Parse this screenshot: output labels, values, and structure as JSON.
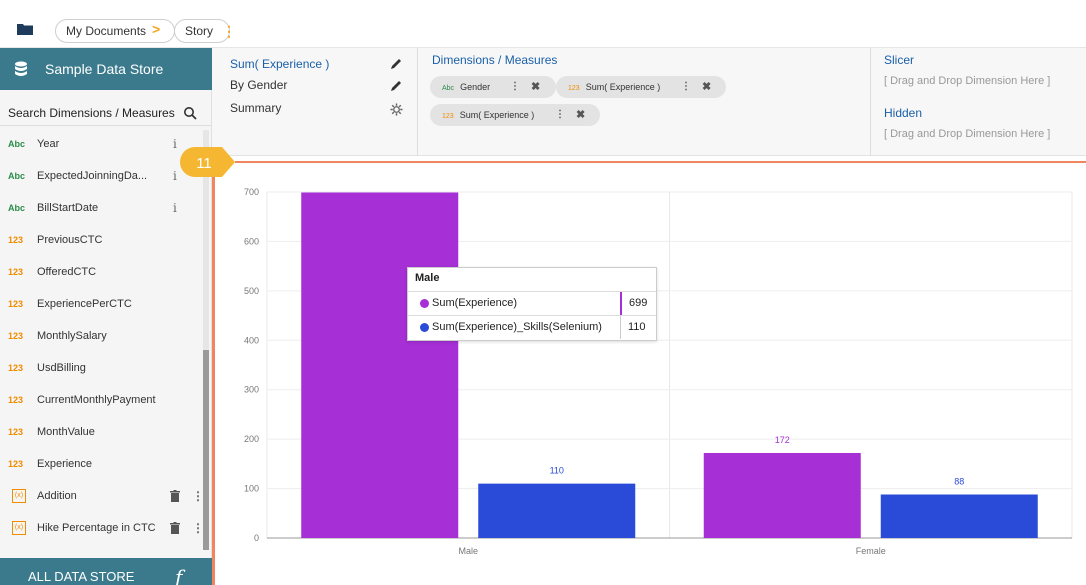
{
  "breadcrumb": {
    "items": [
      "My Documents",
      "Story"
    ]
  },
  "sidebar": {
    "store_title": "Sample Data Store",
    "search_label": "Search Dimensions / Measures",
    "fields": [
      {
        "type": "Abc",
        "name": "Year",
        "action": "info"
      },
      {
        "type": "Abc",
        "name": "ExpectedJoinningDa...",
        "action": "info"
      },
      {
        "type": "Abc",
        "name": "BillStartDate",
        "action": "info"
      },
      {
        "type": "123",
        "name": "PreviousCTC"
      },
      {
        "type": "123",
        "name": "OfferedCTC"
      },
      {
        "type": "123",
        "name": "ExperiencePerCTC"
      },
      {
        "type": "123",
        "name": "MonthlySalary"
      },
      {
        "type": "123",
        "name": "UsdBilling"
      },
      {
        "type": "123",
        "name": "CurrentMonthlyPayment"
      },
      {
        "type": "123",
        "name": "MonthValue"
      },
      {
        "type": "123",
        "name": "Experience"
      },
      {
        "type": "(x)",
        "name": "Addition",
        "action": "trash"
      },
      {
        "type": "(x)",
        "name": "Hike Percentage in CTC",
        "action": "trash"
      }
    ],
    "all_store_label": "ALL DATA STORE",
    "fx_glyph": "f"
  },
  "properties": {
    "items": [
      "Sum( Experience )",
      "By Gender",
      "Summary"
    ]
  },
  "dimensions_measures": {
    "title": "Dimensions / Measures",
    "pills": [
      {
        "type": "Abc",
        "label": "Gender"
      },
      {
        "type": "123",
        "label": "Sum( Experience )"
      },
      {
        "type": "123",
        "label": "Sum( Experience )"
      }
    ]
  },
  "slicer": {
    "title": "Slicer",
    "placeholder": "[ Drag and Drop Dimension Here ]"
  },
  "hidden": {
    "title": "Hidden",
    "placeholder": "[ Drag and Drop Dimension Here ]"
  },
  "step_badge": "11",
  "tooltip": {
    "title": "Male",
    "rows": [
      {
        "label": "Sum(Experience)",
        "value": "699",
        "color": "#a62fd6"
      },
      {
        "label": "Sum(Experience)_Skills(Selenium)",
        "value": "110",
        "color": "#2a4bd7"
      }
    ]
  },
  "colors": {
    "accent": "#f08660",
    "series1": "#a62fd6",
    "series2": "#2a4bd7",
    "header": "#3a7a8c"
  },
  "chart_data": {
    "type": "bar",
    "categories": [
      "Male",
      "Female"
    ],
    "series": [
      {
        "name": "Sum(Experience)",
        "values": [
          699,
          172
        ],
        "color": "#a62fd6",
        "labels": [
          "",
          "172"
        ]
      },
      {
        "name": "Sum(Experience)_Skills(Selenium)",
        "values": [
          110,
          88
        ],
        "color": "#2a4bd7",
        "labels": [
          "110",
          "88"
        ]
      }
    ],
    "ylim": [
      0,
      700
    ],
    "yticks": [
      0,
      100,
      200,
      300,
      400,
      500,
      600,
      700
    ],
    "grid": true
  }
}
